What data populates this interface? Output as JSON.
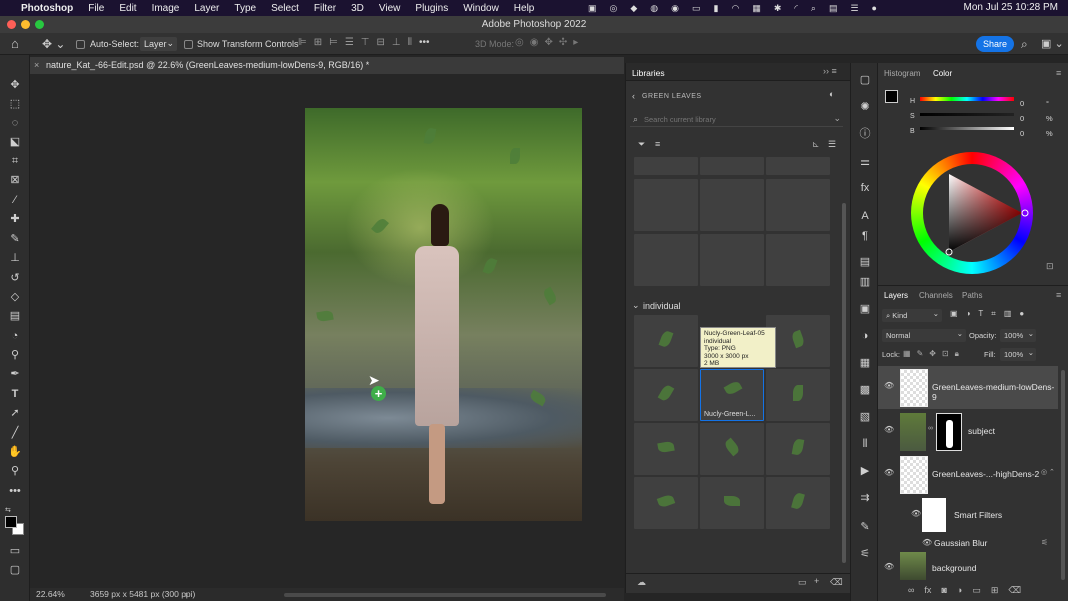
{
  "menubar": {
    "app": "Photoshop",
    "items": [
      "File",
      "Edit",
      "Image",
      "Layer",
      "Type",
      "Select",
      "Filter",
      "3D",
      "View",
      "Plugins",
      "Window",
      "Help"
    ],
    "clock": "Mon Jul 25  10:28 PM"
  },
  "window": {
    "title": "Adobe Photoshop 2022"
  },
  "options": {
    "auto_select_label": "Auto-Select:",
    "auto_select_value": "Layer",
    "show_transform": "Show Transform Controls",
    "mode3d": "3D Mode:",
    "share": "Share"
  },
  "document": {
    "tab_title": "nature_Kat_-66-Edit.psd @ 22.6% (GreenLeaves-medium-lowDens-9, RGB/16) *",
    "zoom": "22.64%",
    "info": "3659 px x 5481 px (300 ppi)"
  },
  "libraries": {
    "tab": "Libraries",
    "library_name": "GREEN LEAVES",
    "search_placeholder": "Search current library",
    "group_label": "individual",
    "tooltip": {
      "name": "Nucly-Green-Leaf-05",
      "group": "individual",
      "type": "Type: PNG",
      "size": "3000 x 3000 px",
      "filesize": "2 MB"
    },
    "selected_caption": "Nucly-Green-L..."
  },
  "color": {
    "tabs": [
      "Histogram",
      "Color"
    ],
    "active_tab": "Color",
    "h_label": "H",
    "h_value": "0",
    "h_unit": "°",
    "s_label": "S",
    "s_value": "0",
    "s_unit": "%",
    "b_label": "B",
    "b_value": "0",
    "b_unit": "%"
  },
  "layers": {
    "tabs": [
      "Layers",
      "Channels",
      "Paths"
    ],
    "active_tab": "Layers",
    "kind": "Kind",
    "blend": "Normal",
    "opacity_label": "Opacity:",
    "opacity": "100%",
    "lock_label": "Lock:",
    "fill_label": "Fill:",
    "fill": "100%",
    "rows": [
      {
        "name": "GreenLeaves-medium-lowDens-9"
      },
      {
        "name": "subject"
      },
      {
        "name": "GreenLeaves-...-highDens-2"
      },
      {
        "name": "Smart Filters"
      },
      {
        "name": "Gaussian Blur"
      },
      {
        "name": "background"
      }
    ]
  },
  "colors": {
    "accent": "#1473e6",
    "leaf": "#4d7e3a",
    "add_badge": "#3fae49"
  }
}
